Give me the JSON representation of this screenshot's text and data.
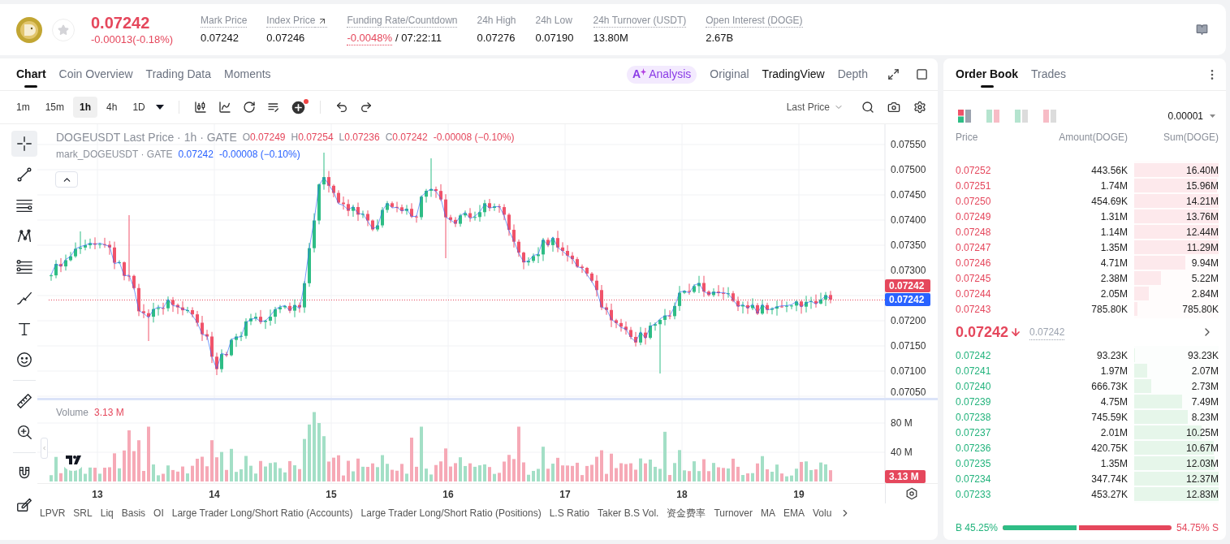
{
  "header": {
    "price": "0.07242",
    "change": "-0.00013(-0.18%)",
    "falling": true,
    "favorite": false,
    "stats": [
      {
        "kind": "plain",
        "label": "Mark Price",
        "value": "0.07242",
        "has_tooltip": true
      },
      {
        "kind": "external",
        "label": "Index Price",
        "value": "0.07246",
        "has_tooltip": true
      },
      {
        "kind": "funding",
        "label": "Funding Rate/Countdown",
        "value": "-0.0048%",
        "countdown": "/ 07:22:11",
        "has_tooltip": true
      },
      {
        "kind": "plain",
        "label": "24h High",
        "value": "0.07276",
        "has_tooltip": false
      },
      {
        "kind": "plain",
        "label": "24h Low",
        "value": "0.07190",
        "has_tooltip": false
      },
      {
        "kind": "plain",
        "label": "24h Turnover (USDT)",
        "value": "13.80M",
        "has_tooltip": true
      },
      {
        "kind": "plain",
        "label": "Open Interest (DOGE)",
        "value": "2.67B",
        "has_tooltip": true
      }
    ]
  },
  "chart_panel": {
    "tabs": [
      {
        "label": "Chart",
        "selected": true
      },
      {
        "label": "Coin Overview",
        "selected": false
      },
      {
        "label": "Trading Data",
        "selected": false
      },
      {
        "label": "Moments",
        "selected": false
      }
    ],
    "analysis": {
      "mark": "A",
      "label": "Analysis"
    },
    "views": [
      {
        "label": "Original",
        "selected": false
      },
      {
        "label": "TradingView",
        "selected": true
      },
      {
        "label": "Depth",
        "selected": false
      }
    ],
    "intervals": [
      {
        "label": "1m",
        "selected": false
      },
      {
        "label": "15m",
        "selected": false
      },
      {
        "label": "1h",
        "selected": true
      },
      {
        "label": "4h",
        "selected": false
      },
      {
        "label": "1D",
        "selected": false
      }
    ],
    "indicator_badge": true,
    "price_source": "Last Price",
    "tool_groups": [
      {
        "tools": [
          {
            "kind": "crosshair",
            "selected": true
          },
          {
            "kind": "trend-line",
            "selected": false
          },
          {
            "kind": "horizontal-line",
            "selected": false
          },
          {
            "kind": "pattern",
            "selected": false
          },
          {
            "kind": "fibonacci",
            "selected": false
          },
          {
            "kind": "brush",
            "selected": false
          },
          {
            "kind": "text",
            "selected": false
          },
          {
            "kind": "emoji",
            "selected": false
          }
        ]
      },
      {
        "tools": [
          {
            "kind": "ruler",
            "selected": false
          },
          {
            "kind": "zoom",
            "selected": false
          }
        ]
      },
      {
        "tools": [
          {
            "kind": "magnet",
            "selected": false
          },
          {
            "kind": "drawing-mode",
            "selected": false
          }
        ]
      }
    ],
    "legend": {
      "title": "DOGEUSDT Last Price · 1h · GATE",
      "ohlc": [
        {
          "label": "O",
          "value": "0.07249"
        },
        {
          "label": "H",
          "value": "0.07254"
        },
        {
          "label": "L",
          "value": "0.07236"
        },
        {
          "label": "C",
          "value": "0.07242"
        }
      ],
      "change": "-0.00008 (−0.10%)",
      "mark_title": "mark_DOGEUSDT · GATE",
      "mark_value": "0.07242",
      "mark_change": "-0.00008 (−0.10%)"
    },
    "price_axis_upper": [
      "0.07550",
      "0.07500",
      "0.07450",
      "0.07400",
      "0.07350",
      "0.07300"
    ],
    "price_axis_lower": [
      "0.07200",
      "0.07150",
      "0.07100",
      "0.07050"
    ],
    "last_price_tag": "0.07242",
    "mark_price_tag": "0.07242",
    "volume": {
      "label": "Volume",
      "value": "3.13 M",
      "axis": [
        "80 M",
        "40 M"
      ],
      "tag": "3.13 M"
    },
    "time_axis": [
      "13",
      "14",
      "15",
      "16",
      "17",
      "18",
      "19"
    ],
    "indicators": [
      "LPVR",
      "SRL",
      "Liq",
      "Basis",
      "OI",
      "Large Trader Long/Short Ratio (Accounts)",
      "Large Trader Long/Short Ratio (Positions)",
      "L.S Ratio",
      "Taker B.S Vol.",
      "资金费率",
      "Turnover",
      "MA",
      "EMA",
      "Volu"
    ]
  },
  "order_book": {
    "tabs": [
      {
        "label": "Order Book",
        "selected": true
      },
      {
        "label": "Trades",
        "selected": false
      }
    ],
    "view_modes": [
      {
        "kind": "both",
        "selected": true
      },
      {
        "kind": "split",
        "selected": false
      },
      {
        "kind": "bids",
        "selected": false
      },
      {
        "kind": "asks",
        "selected": false
      }
    ],
    "precision": "0.00001",
    "columns": [
      "Price",
      "Amount(DOGE)",
      "Sum(DOGE)"
    ],
    "asks": [
      {
        "price": "0.07252",
        "amount": "443.56K",
        "sum": "16.40M",
        "level": 1
      },
      {
        "price": "0.07251",
        "amount": "1.74M",
        "sum": "15.96M",
        "level": 0.98
      },
      {
        "price": "0.07250",
        "amount": "454.69K",
        "sum": "14.21M",
        "level": 1
      },
      {
        "price": "0.07249",
        "amount": "1.31M",
        "sum": "13.76M",
        "level": 1
      },
      {
        "price": "0.07248",
        "amount": "1.14M",
        "sum": "12.44M",
        "level": 1
      },
      {
        "price": "0.07247",
        "amount": "1.35M",
        "sum": "11.29M",
        "level": 1
      },
      {
        "price": "0.07246",
        "amount": "4.71M",
        "sum": "9.94M",
        "level": 0.61
      },
      {
        "price": "0.07245",
        "amount": "2.38M",
        "sum": "5.22M",
        "level": 0.32
      },
      {
        "price": "0.07244",
        "amount": "2.05M",
        "sum": "2.84M",
        "level": 0.17
      },
      {
        "price": "0.07243",
        "amount": "785.80K",
        "sum": "785.80K",
        "level": 0.04
      }
    ],
    "last_price": "0.07242",
    "falling": true,
    "mark_price": "0.07242",
    "bids": [
      {
        "price": "0.07242",
        "amount": "93.23K",
        "sum": "93.23K",
        "level": 0.01
      },
      {
        "price": "0.07241",
        "amount": "1.97M",
        "sum": "2.07M",
        "level": 0.15
      },
      {
        "price": "0.07240",
        "amount": "666.73K",
        "sum": "2.73M",
        "level": 0.2
      },
      {
        "price": "0.07239",
        "amount": "4.75M",
        "sum": "7.49M",
        "level": 0.57
      },
      {
        "price": "0.07238",
        "amount": "745.59K",
        "sum": "8.23M",
        "level": 0.63
      },
      {
        "price": "0.07237",
        "amount": "2.01M",
        "sum": "10.25M",
        "level": 0.8
      },
      {
        "price": "0.07236",
        "amount": "420.75K",
        "sum": "10.67M",
        "level": 0.94
      },
      {
        "price": "0.07235",
        "amount": "1.35M",
        "sum": "12.03M",
        "level": 0.95
      },
      {
        "price": "0.07234",
        "amount": "347.74K",
        "sum": "12.37M",
        "level": 1
      },
      {
        "price": "0.07233",
        "amount": "453.27K",
        "sum": "12.83M",
        "level": 1
      }
    ],
    "ratio": {
      "buy_label": "B 45.25%",
      "sell_label": "54.75% S",
      "level": 0.4525
    }
  }
}
